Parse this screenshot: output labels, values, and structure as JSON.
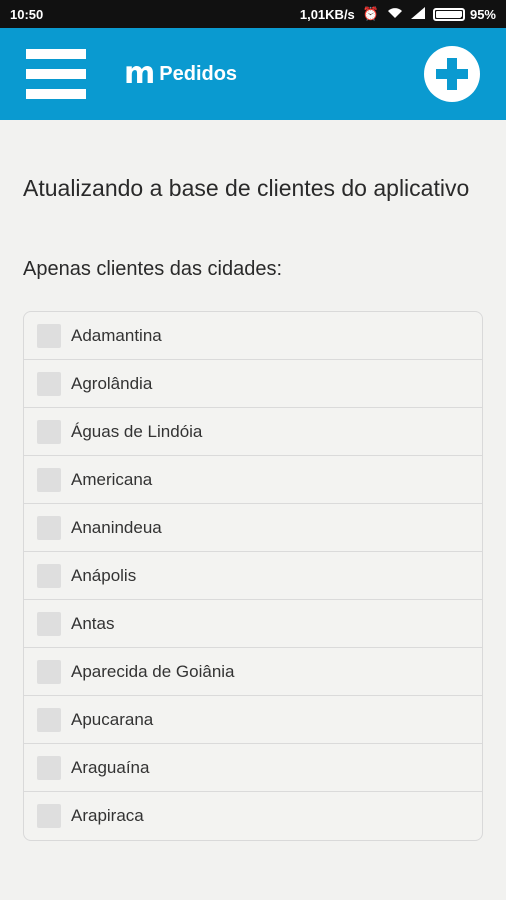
{
  "status_bar": {
    "time": "10:50",
    "network_speed": "1,01KB/s",
    "battery": "95%",
    "battery_level": 0.95
  },
  "app_bar": {
    "logo_mark": "m",
    "title": "Pedidos"
  },
  "main": {
    "title": "Atualizando a base de clientes do aplicativo",
    "subtitle": "Apenas clientes das cidades:",
    "cities": [
      "Adamantina",
      "Agrolândia",
      "Águas de Lindóia",
      "Americana",
      "Ananindeua",
      "Anápolis",
      "Antas",
      "Aparecida de Goiânia",
      "Apucarana",
      "Araguaína",
      "Arapiraca"
    ]
  },
  "colors": {
    "accent": "#0a9ad0"
  }
}
